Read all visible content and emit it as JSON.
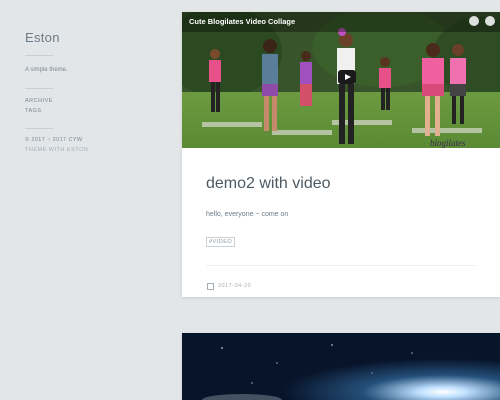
{
  "site": {
    "title": "Eston",
    "tagline": "A simple theme.",
    "nav": [
      {
        "label": "ARCHIVE"
      },
      {
        "label": "TAGS"
      }
    ],
    "copyright": "© 2017 ~ 2017 CYW",
    "credit": "THEME WITH ESTON"
  },
  "post": {
    "video_title": "Cute Blogilates Video Collage",
    "video_watermark": "blogilates",
    "title": "demo2 with video",
    "excerpt": "hello, everyone ~ come on",
    "tag": "#VIDEO",
    "date": "2017-04-20"
  },
  "colors": {
    "background": "#e3e6e8",
    "card": "#ffffff",
    "text": "#4d5a64",
    "muted": "#a3aeb6"
  }
}
